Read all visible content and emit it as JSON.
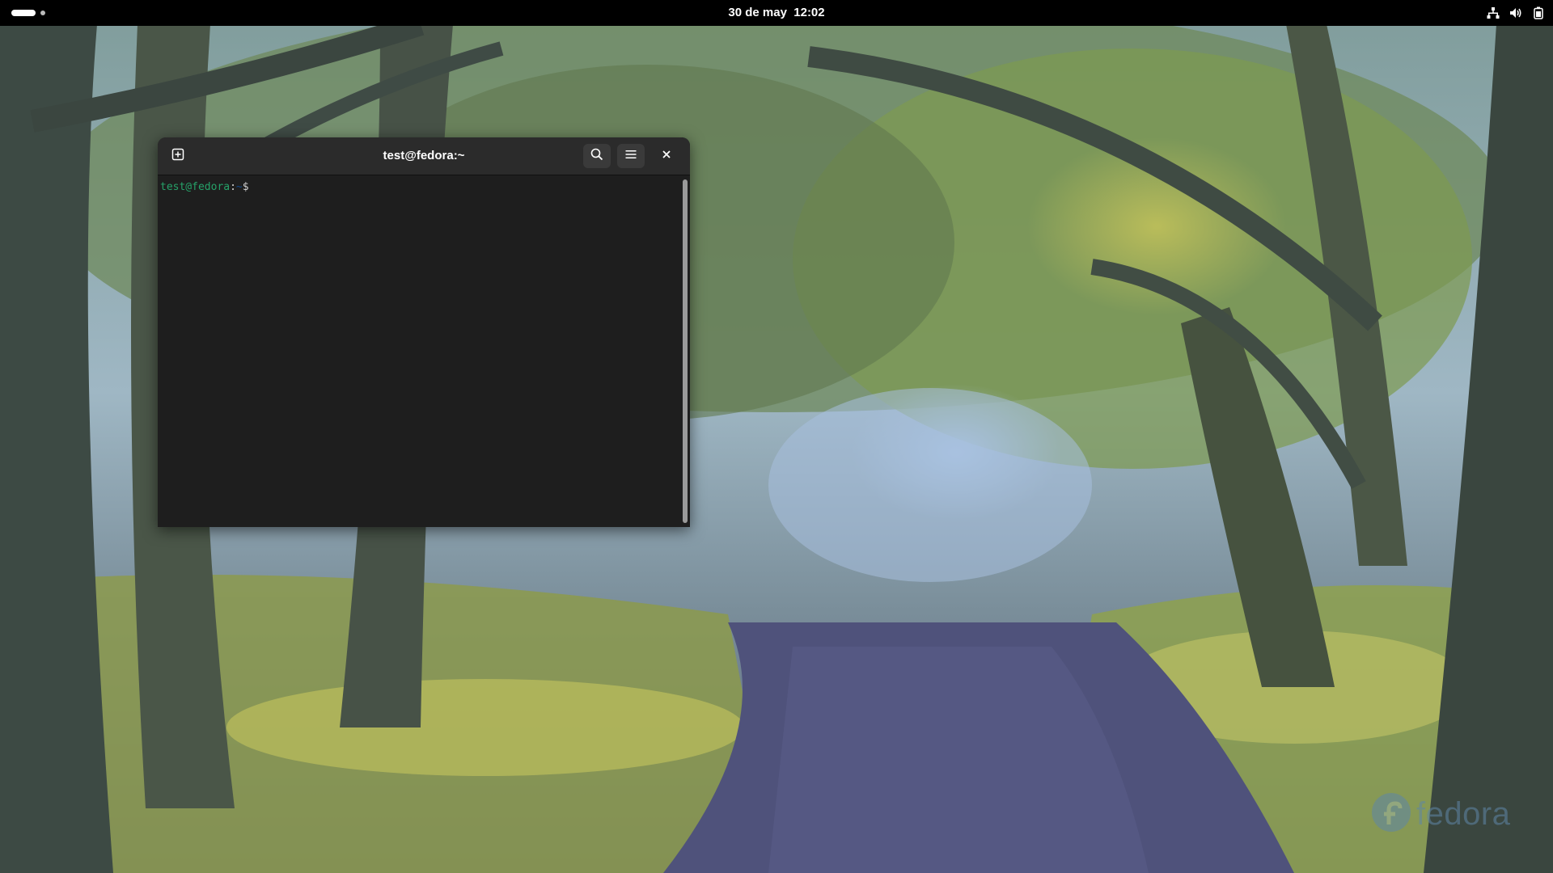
{
  "topbar": {
    "clock": "30 de may  12:02",
    "icons": [
      "network-wired-icon",
      "volume-icon",
      "battery-icon"
    ]
  },
  "terminal": {
    "title": "test@fedora:~",
    "icons": [
      "new-tab-icon",
      "search-icon",
      "hamburger-menu-icon",
      "close-icon"
    ],
    "prompt": {
      "user_host": "test@fedora",
      "separator": ":",
      "path": "~",
      "symbol": "$"
    }
  },
  "branding": {
    "logo_text": "fedora"
  },
  "colors": {
    "topbar_bg": "#000000",
    "terminal_bg": "#1e1e1e",
    "headerbar_bg": "#2b2b2b",
    "prompt_user": "#26a269",
    "prompt_path": "#12488b",
    "fedora_blue": "#5f86a8"
  }
}
